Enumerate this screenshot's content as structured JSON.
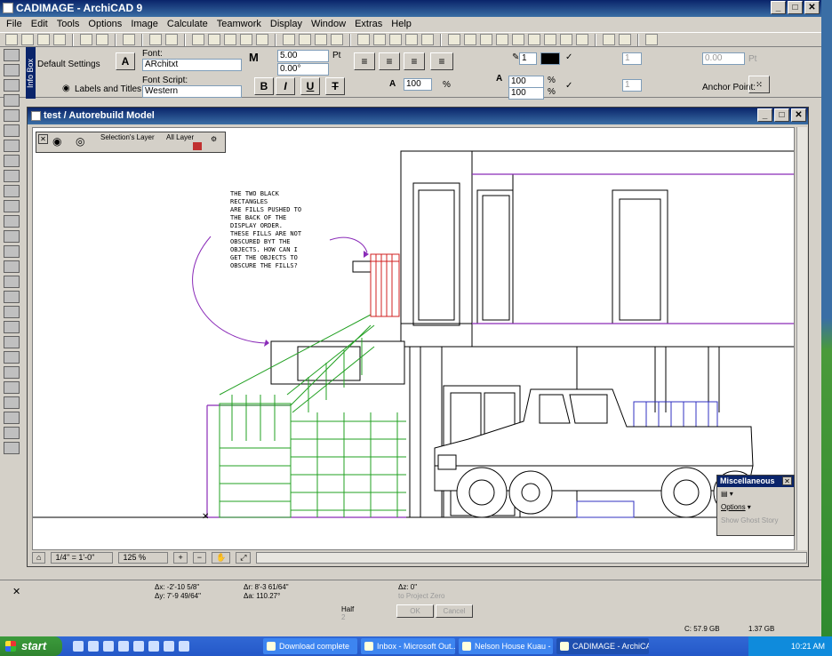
{
  "app": {
    "title": "CADIMAGE - ArchiCAD 9"
  },
  "window_buttons": {
    "minimize": "_",
    "maximize": "□",
    "close": "✕"
  },
  "menu": [
    "File",
    "Edit",
    "Tools",
    "Options",
    "Image",
    "Calculate",
    "Teamwork",
    "Display",
    "Window",
    "Extras",
    "Help"
  ],
  "infobox": {
    "tab_label": "Info Box",
    "default_settings": "Default Settings",
    "labels_and_titles": "Labels and Titles",
    "font_label": "Font:",
    "font_value": "ARchitxt",
    "font_script_label": "Font Script:",
    "font_script_value": "Western",
    "size_value": "5.00",
    "size_unit": "Pt",
    "angle_value": "0.00°",
    "bold": "B",
    "italic": "I",
    "underline": "U",
    "strike": "T",
    "width_pct": "100",
    "pct": "%",
    "spacing1": "100",
    "spacing2": "100",
    "pen_value": "1",
    "anchor_point": "Anchor Point:",
    "dim_value1": "1",
    "dim_value2": "0.00",
    "dim_unit": "Pt"
  },
  "doc": {
    "title": "test  / Autorebuild Model",
    "scale": "1/4\"  =  1'-0\"",
    "zoom": "125 %"
  },
  "layer_palette": {
    "selections_layer": "Selection's Layer",
    "all_layer": "All Layer"
  },
  "annotation": {
    "lines": [
      "THE TWO BLACK",
      "RECTANGLES",
      "ARE FILLS PUSHED TO",
      "THE BACK OF THE",
      "DISPLAY ORDER.",
      "THESE FILLS ARE NOT",
      "OBSCURED BYT THE",
      "OBJECTS.  HOW CAN I",
      "GET THE OBJECTS TO",
      "OBSCURE THE FILLS?"
    ]
  },
  "misc_palette": {
    "title": "Miscellaneous",
    "options": "Options",
    "show_ghost": "Show Ghost Story"
  },
  "coords": {
    "dx": "Δx: -2'-10 5/8\"",
    "dy": "Δy: 7'-9 49/64\"",
    "dr": "Δr: 8'-3 61/64\"",
    "da": "Δa: 110.27°",
    "dz": "Δz: 0\"",
    "to_project_zero": "to Project Zero",
    "half": "Half",
    "half_val": "2",
    "ok": "OK",
    "cancel": "Cancel"
  },
  "disk": {
    "c_free": "C: 57.9 GB",
    "mem": "1.37 GB"
  },
  "taskbar": {
    "start": "start",
    "tasks": [
      "Download complete",
      "Inbox - Microsoft Out...",
      "Nelson House Kuau - ...",
      "CADIMAGE - ArchiCA..."
    ],
    "clock": "10:21 AM"
  },
  "colors": {
    "title_blue": "#0a246a",
    "stair_green": "#22a022",
    "wall_purple": "#8a2bb8",
    "railing_red": "#d02020",
    "railing_blue": "#3030c0"
  }
}
